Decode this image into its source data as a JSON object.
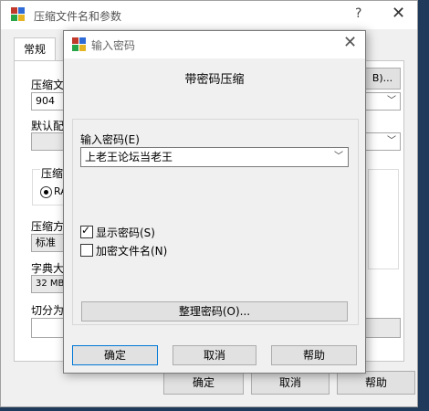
{
  "parent": {
    "title": "压缩文件名和参数",
    "help_glyph": "?",
    "close_glyph": "✕",
    "tab_general": "常规",
    "archive_label": "压缩文",
    "archive_value": "904",
    "browse_button": "B)...",
    "profile_label": "默认配",
    "format_label": "压缩",
    "format_radio": "RA",
    "method_label": "压缩方",
    "method_value": "标准",
    "dict_label": "字典大",
    "dict_value": "32 MB",
    "split_label": "切分为",
    "ok_button": "确定",
    "cancel_button": "取消",
    "help_button": "帮助"
  },
  "dialog": {
    "title": "输入密码",
    "heading": "带密码压缩",
    "password_label": "输入密码(E)",
    "password_value": "上老王论坛当老王",
    "show_password": "显示密码(S)",
    "encrypt_filenames": "加密文件名(N)",
    "organize_button": "整理密码(O)...",
    "ok_button": "确定",
    "cancel_button": "取消",
    "help_button": "帮助",
    "show_password_checked": true,
    "encrypt_filenames_checked": false
  },
  "colors": {
    "accent": "#0078d7",
    "dark_bg": "#1f3a5a"
  }
}
